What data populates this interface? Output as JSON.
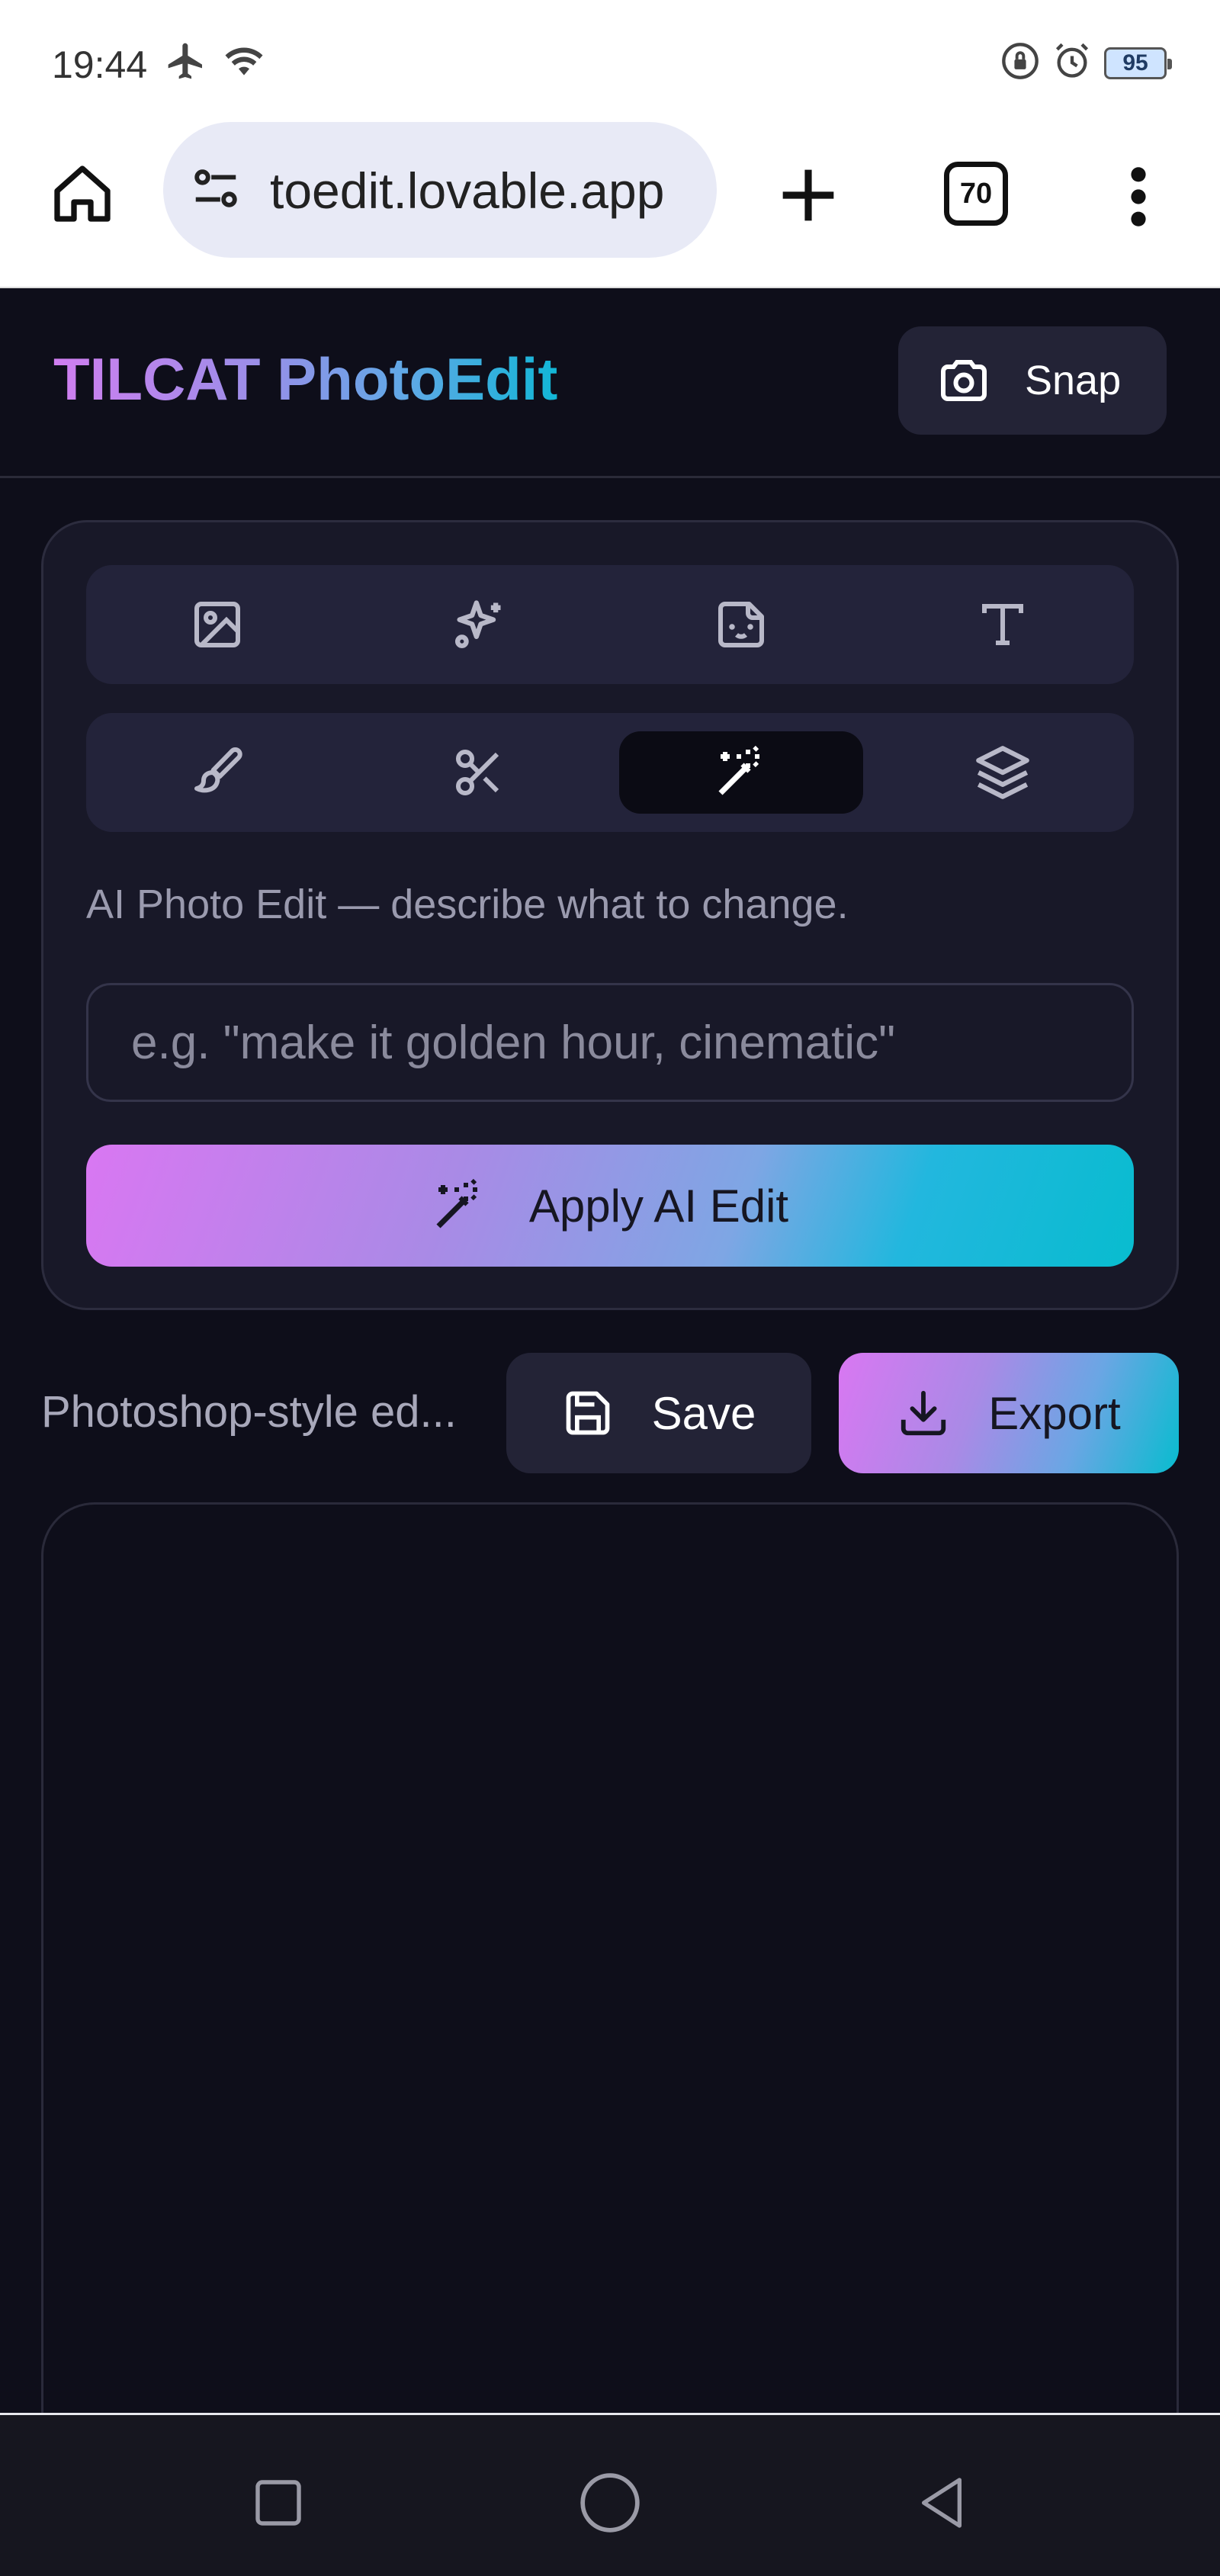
{
  "status_bar": {
    "time": "19:44",
    "icons_left": [
      "airplane-icon",
      "wifi-icon"
    ],
    "icons_right": [
      "lock-rotation-icon",
      "alarm-icon"
    ],
    "battery": "95"
  },
  "browser": {
    "url": "toedit.lovable.app",
    "tab_count": "70"
  },
  "app": {
    "brand_part1": "TILCAT",
    "brand_part2": "PhotoEdit",
    "snap_label": "Snap"
  },
  "tools": {
    "row1": [
      "image-icon",
      "sparkles-icon",
      "sticker-icon",
      "text-icon"
    ],
    "row2": [
      "brush-icon",
      "scissors-icon",
      "magic-wand-icon",
      "layers-icon"
    ],
    "active": "magic-wand-icon"
  },
  "ai_edit": {
    "hint": "AI Photo Edit — describe what to change.",
    "placeholder": "e.g. \"make it golden hour, cinematic\"",
    "value": "",
    "apply_label": "Apply AI Edit"
  },
  "actions": {
    "label": "Photoshop-style ed...",
    "save_label": "Save",
    "export_label": "Export"
  },
  "colors": {
    "background": "#0e0e1a",
    "card": "#181828",
    "gradient_start": "#d977f2",
    "gradient_end": "#08bccf"
  }
}
